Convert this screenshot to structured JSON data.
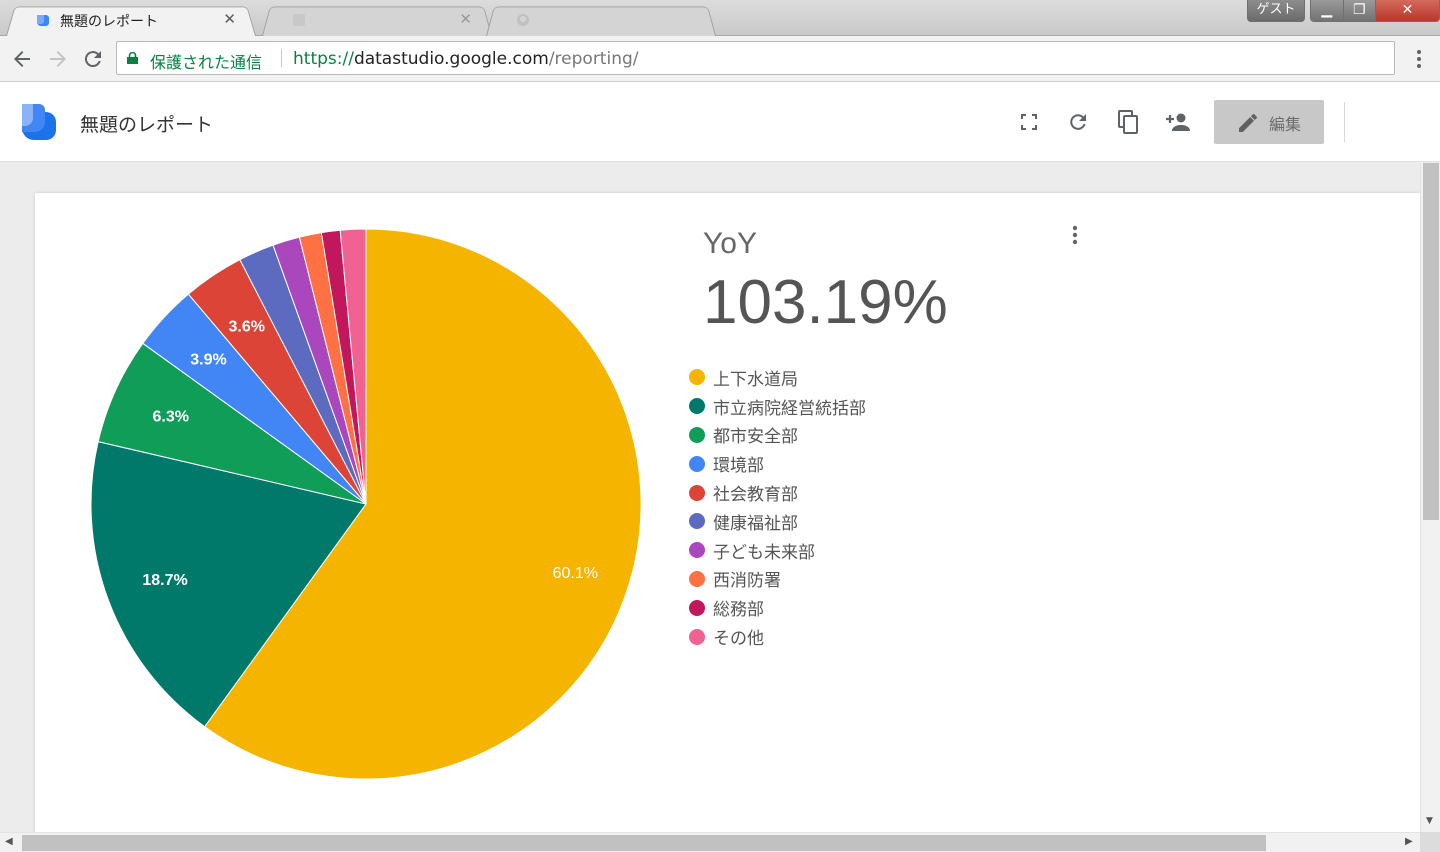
{
  "browser": {
    "tabs": [
      {
        "title": "無題のレポート",
        "active": true
      },
      {
        "title": "",
        "active": false
      },
      {
        "title": "",
        "active": false
      }
    ],
    "guest_label": "ゲスト",
    "secure_label": "保護された通信",
    "url": {
      "scheme": "https://",
      "host": "datastudio.google.com",
      "path": "/reporting/"
    }
  },
  "app": {
    "report_title": "無題のレポート",
    "edit_label": "編集",
    "icons": [
      "fullscreen-icon",
      "refresh-icon",
      "copy-icon",
      "share-person-add-icon",
      "pencil-icon"
    ],
    "brand_color": "#4285f4"
  },
  "kpi": {
    "label": "YoY",
    "value": "103.19%"
  },
  "chart_data": {
    "type": "pie",
    "title": "",
    "legend_position": "right",
    "slices": [
      {
        "name": "上下水道局",
        "value": 60.1,
        "label": "60.1%",
        "color": "#f4b400"
      },
      {
        "name": "市立病院経営統括部",
        "value": 18.7,
        "label": "18.7%",
        "color": "#00796b"
      },
      {
        "name": "都市安全部",
        "value": 6.3,
        "label": "6.3%",
        "color": "#0f9d58"
      },
      {
        "name": "環境部",
        "value": 3.9,
        "label": "3.9%",
        "color": "#4285f4"
      },
      {
        "name": "社会教育部",
        "value": 3.6,
        "label": "3.6%",
        "color": "#db4437"
      },
      {
        "name": "健康福祉部",
        "value": 2.1,
        "label": "",
        "color": "#5c6bc0"
      },
      {
        "name": "子ども未来部",
        "value": 1.6,
        "label": "",
        "color": "#ab47bc"
      },
      {
        "name": "西消防署",
        "value": 1.3,
        "label": "",
        "color": "#ff7043"
      },
      {
        "name": "総務部",
        "value": 1.1,
        "label": "",
        "color": "#c2185b"
      },
      {
        "name": "その他",
        "value": 1.5,
        "label": "",
        "color": "#f06292"
      }
    ]
  }
}
